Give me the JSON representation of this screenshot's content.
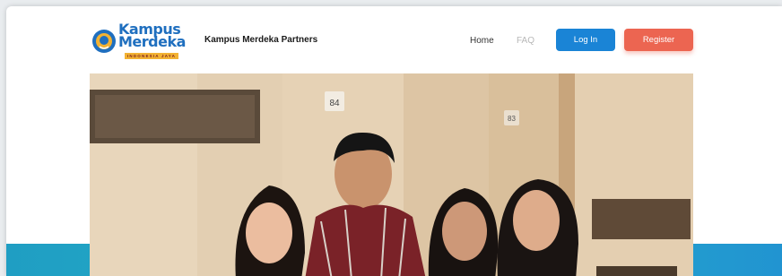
{
  "logo": {
    "line1": "Kampus",
    "line2": "Merdeka",
    "tagline": "INDONESIA JAYA"
  },
  "nav": {
    "brand": "Kampus Merdeka Partners",
    "home": "Home",
    "faq": "FAQ",
    "login": "Log In",
    "register": "Register"
  },
  "hero": {
    "door_number_1": "84",
    "door_number_2": "83"
  },
  "colors": {
    "primary_button": "#1a84d6",
    "register_button": "#ec6551",
    "band": "#27b0c8"
  }
}
